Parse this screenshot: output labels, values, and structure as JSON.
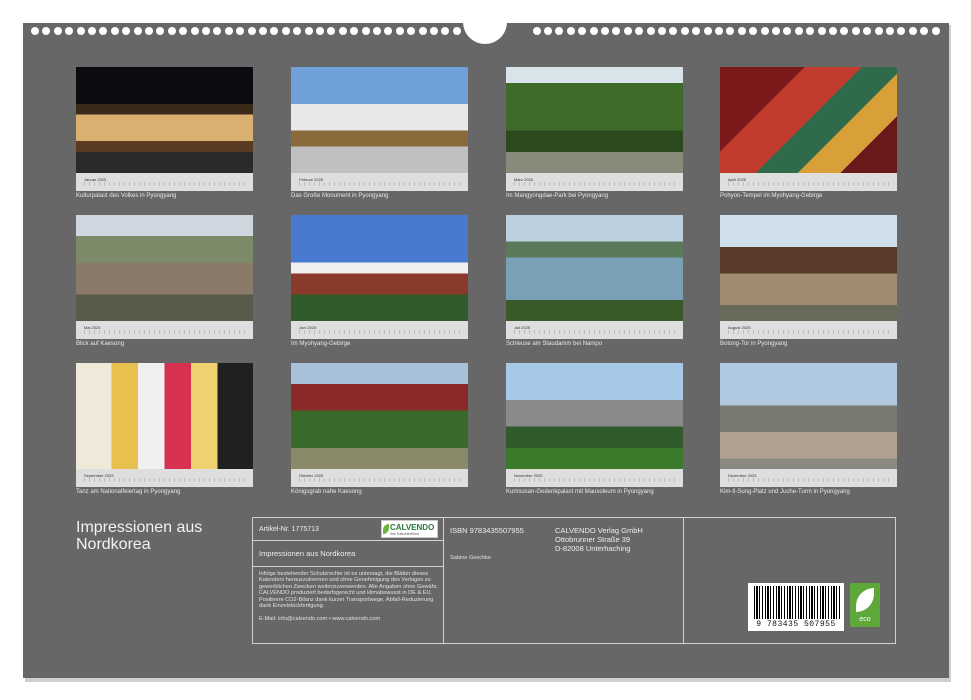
{
  "calendar": {
    "title_line1": "Impressionen aus",
    "title_line2": "Nordkorea"
  },
  "months": [
    {
      "month": "Januar 2025",
      "caption": "Kulturpalast des Volkes in Pyongyang"
    },
    {
      "month": "Februar 2025",
      "caption": "Das Große Monument in Pyongyang"
    },
    {
      "month": "März 2025",
      "caption": "Im Mangyongdae-Park bei Pyongyang"
    },
    {
      "month": "April 2025",
      "caption": "Pohyon-Tempel im Myohyang-Gebirge"
    },
    {
      "month": "Mai 2025",
      "caption": "Blick auf Kaesong"
    },
    {
      "month": "Juni 2025",
      "caption": "Im Myohyang-Gebirge"
    },
    {
      "month": "Juli 2025",
      "caption": "Schleuse am Staudamm bei Nampo"
    },
    {
      "month": "August 2025",
      "caption": "Botong-Tor in Pyongyang"
    },
    {
      "month": "September 2025",
      "caption": "Tanz am Nationalfeiertag in Pyongyang"
    },
    {
      "month": "Oktober 2025",
      "caption": "Königsgrab nahe Kaesong"
    },
    {
      "month": "November 2025",
      "caption": "Kumsusan-Gedenkpalast mit Mausoleum in Pyongyang"
    },
    {
      "month": "Dezember 2025",
      "caption": "Kim-Il-Sung-Platz und Juche-Turm in Pyongyang"
    }
  ],
  "info": {
    "article_no": "Artikel-Nr. 1775713",
    "product_title": "Impressionen aus Nordkorea",
    "logo_text": "CALVENDO",
    "logo_sub": "Ihre Kalenderfirma",
    "legal_text": "Infolge bestehender Schutzrechte ist es untersagt, die Blätter dieses Kalenders herauszutrennen und ohne Genehmigung des Verlages zu gewerblichen Zwecken weiterzuverwenden. Alle Angaben ohne Gewähr. CALVENDO produziert bedarfsgerecht und klimabewusst in DE & EU. Positivere CO2-Bilanz dank kurzer Transportwege, Abfall-Reduzierung dank Einzelstückfertigung.",
    "contact": "E-Mail: info@calvendo.com • www.calvendo.com",
    "isbn": "ISBN 9783435507955",
    "author": "Sabine Geschke",
    "publisher_name": "CALVENDO Verlag GmbH",
    "publisher_street": "Ottobrunner Straße 39",
    "publisher_city": "D-82008 Unterhaching",
    "barcode_number": "9 783435 507955",
    "eco_label": "eco"
  },
  "colors": {
    "sheet_background": "#676767",
    "strip": "#dedede",
    "eco_green": "#5ea83a"
  }
}
